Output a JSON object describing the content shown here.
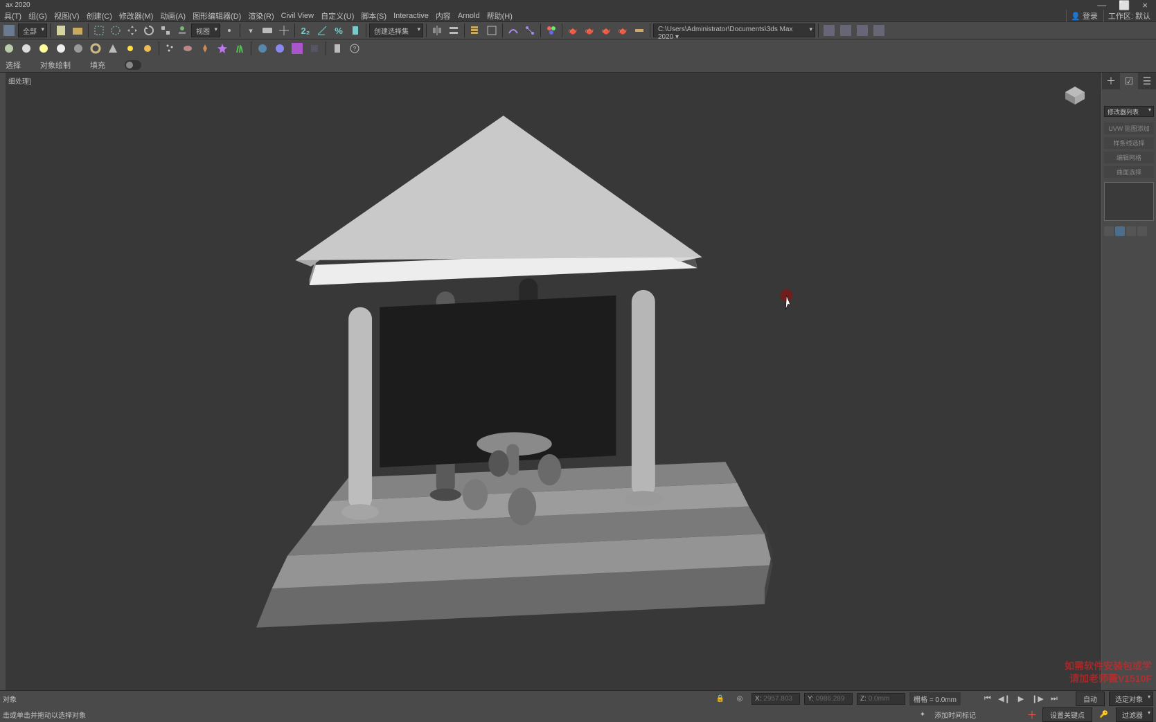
{
  "title": "ax 2020",
  "windowControls": {
    "min": "—",
    "max": "⬜",
    "close": "×"
  },
  "menu": [
    "具(T)",
    "组(G)",
    "视图(V)",
    "创建(C)",
    "修改器(M)",
    "动画(A)",
    "图形编辑器(D)",
    "渲染(R)",
    "Civil View",
    "自定义(U)",
    "脚本(S)",
    "Interactive",
    "内容",
    "Arnold",
    "帮助(H)"
  ],
  "topRight": {
    "login": "登录",
    "workspace_label": "工作区:",
    "workspace_value": "默认"
  },
  "toolbar1": {
    "dropdown1": "全部",
    "view_btn": "视图",
    "big2": "2₂",
    "percent": "%",
    "sel_set_label": "创建选择集",
    "path": "C:\\Users\\Administrator\\Documents\\3ds Max 2020 ▾"
  },
  "ribbon": {
    "tabs": [
      "选择",
      "对象绘制",
      "填充"
    ]
  },
  "viewport": {
    "label": "细处理]"
  },
  "cmdpanel": {
    "modifier_list_label": "修改器列表",
    "items": [
      "UVW 贴图添加",
      "样条线选择",
      "编辑网格",
      "曲面选择"
    ]
  },
  "status": {
    "prompt1": "对象",
    "prompt2": "击或单击并拖动以选择对象",
    "X_label": "X:",
    "X_val": "2957.803",
    "Y_label": "Y:",
    "Y_val": "0986.289",
    "Z_label": "Z:",
    "Z_val": "0.0mm",
    "grid_label": "栅格",
    "grid_val": "= 0.0mm",
    "add_time_tag": "添加时间标记",
    "auto": "自动",
    "selected_obj": "选定对象",
    "set_key": "设置关键点",
    "filter": "过滤器"
  },
  "watermark": {
    "l1": "如需软件安装包或学",
    "l2": "请加老师薇V1510F"
  }
}
